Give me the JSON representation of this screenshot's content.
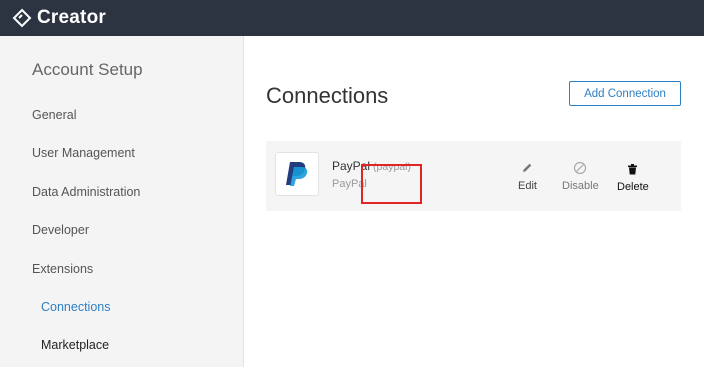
{
  "app": {
    "name": "Creator"
  },
  "sidebar": {
    "title": "Account Setup",
    "items": [
      {
        "label": "General"
      },
      {
        "label": "User Management"
      },
      {
        "label": "Data Administration"
      },
      {
        "label": "Developer"
      },
      {
        "label": "Extensions"
      }
    ],
    "subitems": [
      {
        "label": "Connections",
        "active": true
      },
      {
        "label": "Marketplace",
        "active": false
      }
    ]
  },
  "main": {
    "title": "Connections",
    "add_button_label": "Add Connection",
    "connection": {
      "name": "PayPal",
      "code": "(paypal)",
      "service": "PayPal",
      "actions": [
        {
          "label": "Edit",
          "icon": "pencil-icon"
        },
        {
          "label": "Disable",
          "icon": "disable-icon"
        },
        {
          "label": "Delete",
          "icon": "trash-icon"
        }
      ]
    }
  },
  "colors": {
    "topbar": "#2c3341",
    "accent": "#2d7fc4",
    "highlight": "#e02525"
  }
}
